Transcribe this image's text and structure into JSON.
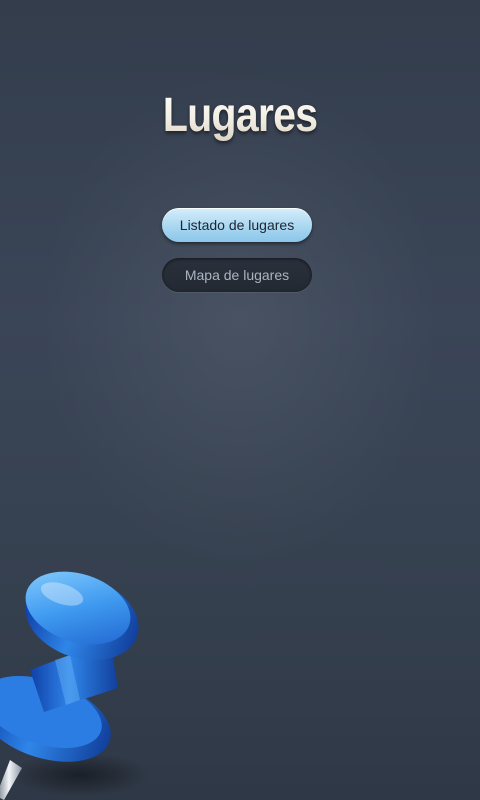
{
  "header": {
    "title": "Lugares"
  },
  "menu": {
    "list_button_label": "Listado de lugares",
    "map_button_label": "Mapa de lugares"
  },
  "decoration": {
    "icon": "push-pin-icon",
    "pin_color": "#2a6fd6"
  },
  "colors": {
    "background": "#3a4557",
    "primary_button": "#a9d7f1",
    "secondary_button": "#232932"
  }
}
